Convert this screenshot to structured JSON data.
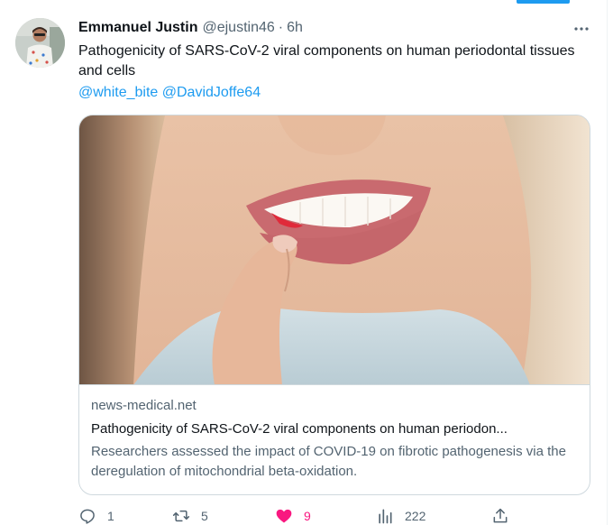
{
  "tweet": {
    "author": {
      "display_name": "Emmanuel Justin",
      "handle": "@ejustin46"
    },
    "separator": "·",
    "time": "6h",
    "text": "Pathogenicity of SARS-CoV-2 viral components on human periodontal tissues and cells",
    "mentions": [
      "@white_bite",
      "@DavidJoffe64"
    ],
    "card": {
      "domain": "news-medical.net",
      "title": "Pathogenicity of SARS-CoV-2 viral components on human periodon...",
      "description": "Researchers assessed the impact of COVID-19 on fibrotic pathogenesis via the deregulation of mitochondrial beta-oxidation."
    },
    "actions": {
      "reply": {
        "icon": "reply-icon",
        "count": "1"
      },
      "retweet": {
        "icon": "retweet-icon",
        "count": "5"
      },
      "like": {
        "icon": "heart-filled-icon",
        "count": "9",
        "liked": true
      },
      "views": {
        "icon": "views-chart-icon",
        "count": "222"
      },
      "share": {
        "icon": "share-icon",
        "count": ""
      }
    }
  },
  "colors": {
    "accent": "#1d9bf0",
    "like": "#f91880",
    "text_primary": "#0f1419",
    "text_secondary": "#536471",
    "border": "#cfd9de"
  }
}
